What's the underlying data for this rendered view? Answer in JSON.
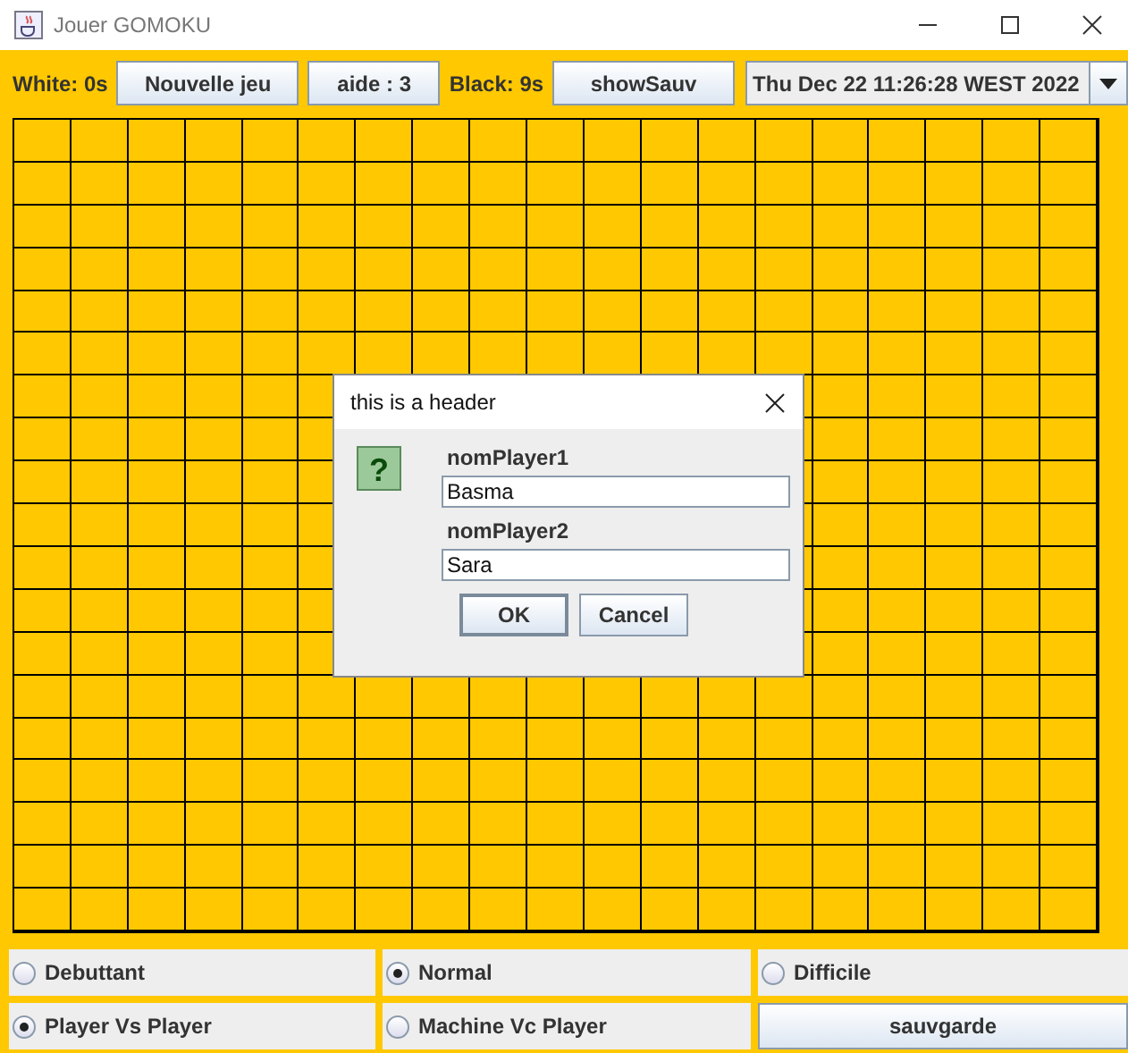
{
  "window": {
    "title": "Jouer GOMOKU"
  },
  "toolbar": {
    "white_timer": "White: 0s",
    "new_game_button": "Nouvelle jeu",
    "help_button": "aide : 3",
    "black_timer": "Black: 9s",
    "show_saves_button": "showSauv",
    "date_combo": "Thu Dec 22 11:26:28 WEST 2022"
  },
  "dialog": {
    "title": "this is a header",
    "icon": "?",
    "fields": [
      {
        "label": "nomPlayer1",
        "value": "Basma"
      },
      {
        "label": "nomPlayer2",
        "value": "Sara"
      }
    ],
    "buttons": [
      {
        "label": "OK",
        "default": true
      },
      {
        "label": "Cancel",
        "default": false
      }
    ]
  },
  "difficulty": [
    {
      "label": "Debuttant",
      "selected": false
    },
    {
      "label": "Normal",
      "selected": true
    },
    {
      "label": "Difficile",
      "selected": false
    }
  ],
  "mode": [
    {
      "label": "Player Vs Player",
      "selected": true
    },
    {
      "label": "Machine Vc Player",
      "selected": false
    }
  ],
  "save_button": "sauvgarde"
}
